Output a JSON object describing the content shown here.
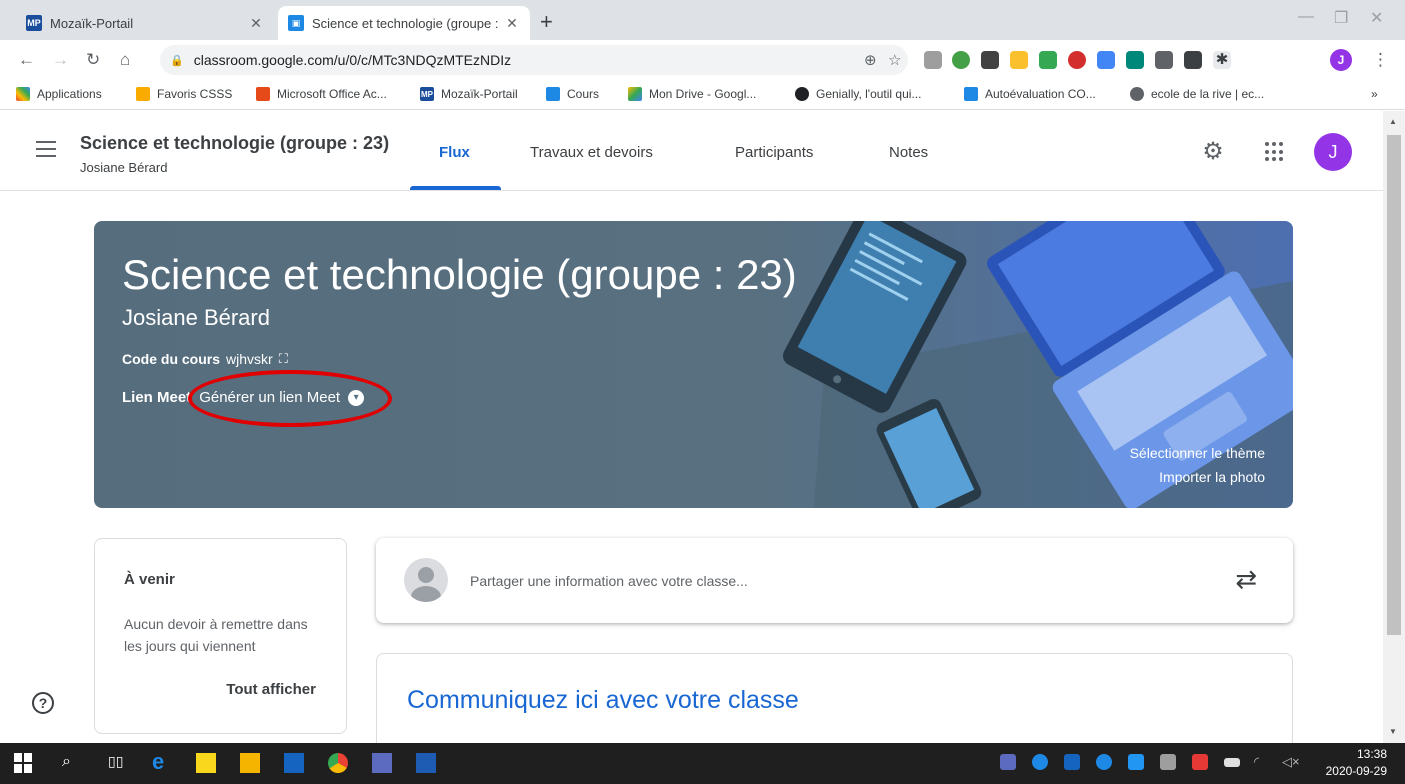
{
  "browser": {
    "tabs": [
      {
        "title": "Mozaïk-Portail",
        "favicon": "MP",
        "active": false
      },
      {
        "title": "Science et technologie (groupe :",
        "favicon": "classroom",
        "active": true
      }
    ],
    "url": "classroom.google.com/u/0/c/MTc3NDQzMTEzNDIz",
    "profile_initial": "J",
    "bookmarks": [
      {
        "label": "Applications",
        "icon": "apps-grid-icon"
      },
      {
        "label": "Favoris CSSS",
        "icon": "folder-icon"
      },
      {
        "label": "Microsoft Office Ac...",
        "icon": "office-icon"
      },
      {
        "label": "Mozaïk-Portail",
        "icon": "mp-icon"
      },
      {
        "label": "Cours",
        "icon": "classroom-icon"
      },
      {
        "label": "Mon Drive - Googl...",
        "icon": "drive-icon"
      },
      {
        "label": "Genially, l'outil qui...",
        "icon": "genially-icon"
      },
      {
        "label": "Autoévaluation CO...",
        "icon": "teams-icon"
      },
      {
        "label": "ecole de la rive | ec...",
        "icon": "globe-icon"
      }
    ],
    "bookmarks_more": "»"
  },
  "header": {
    "class_name": "Science et technologie (groupe : 23)",
    "teacher": "Josiane Bérard",
    "tabs": [
      "Flux",
      "Travaux et devoirs",
      "Participants",
      "Notes"
    ],
    "active_tab": "Flux",
    "avatar_initial": "J"
  },
  "banner": {
    "title": "Science et technologie (groupe : 23)",
    "teacher": "Josiane Bérard",
    "code_label": "Code du cours",
    "code_value": "wjhvskr",
    "meet_label": "Lien Meet",
    "meet_action": "Générer un lien Meet",
    "select_theme": "Sélectionner le thème",
    "import_photo": "Importer la photo"
  },
  "upcoming": {
    "title": "À venir",
    "text": "Aucun devoir à remettre dans les jours qui viennent",
    "link": "Tout afficher"
  },
  "share": {
    "placeholder": "Partager une information avec votre classe..."
  },
  "communicate": {
    "title": "Communiquez ici avec votre classe"
  },
  "taskbar": {
    "time": "13:38",
    "date": "2020-09-29"
  },
  "colors": {
    "accent": "#1967d2",
    "avatar": "#9334e6",
    "annotation": "#e00000"
  }
}
